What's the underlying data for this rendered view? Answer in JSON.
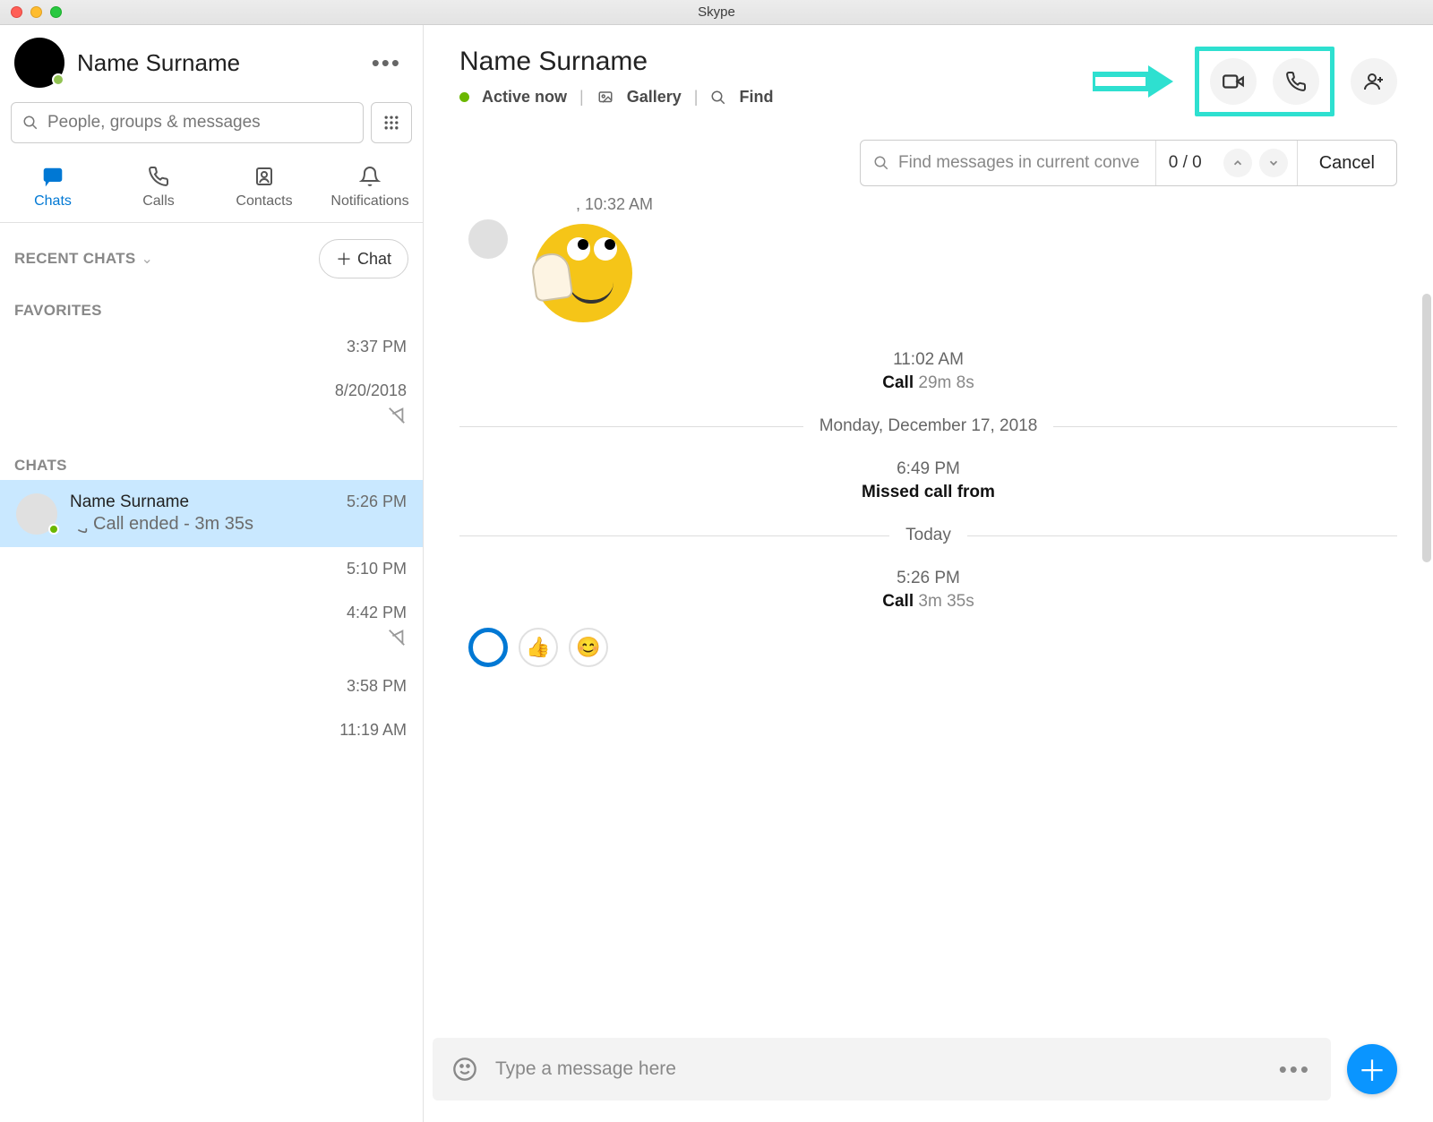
{
  "window": {
    "title": "Skype"
  },
  "profile": {
    "name": "Name Surname"
  },
  "search": {
    "placeholder": "People, groups & messages"
  },
  "tabs": {
    "chats": "Chats",
    "calls": "Calls",
    "contacts": "Contacts",
    "notifications": "Notifications",
    "active": "chats"
  },
  "recent": {
    "title": "RECENT CHATS",
    "new_chat_label": "Chat"
  },
  "favorites": {
    "title": "FAVORITES"
  },
  "chats_section": {
    "title": "CHATS"
  },
  "sidebar_items": [
    {
      "time": "3:37 PM"
    },
    {
      "time": "8/20/2018",
      "muted": true
    },
    {
      "selected": true,
      "name": "Name Surname",
      "sub": "Call ended - 3m 35s",
      "time": "5:26 PM"
    },
    {
      "time": "5:10 PM"
    },
    {
      "time": "4:42 PM",
      "muted": true
    },
    {
      "time": "3:58 PM"
    },
    {
      "time": "11:19 AM"
    }
  ],
  "conversation": {
    "title": "Name Surname",
    "status": "Active now",
    "gallery": "Gallery",
    "find": "Find"
  },
  "find_bar": {
    "placeholder": "Find messages in current conve",
    "count": "0 / 0",
    "cancel": "Cancel"
  },
  "messages": {
    "top_time": ", 10:32 AM",
    "call1": {
      "time": "11:02 AM",
      "label": "Call",
      "duration": "29m 8s"
    },
    "day1": "Monday, December 17, 2018",
    "missed": {
      "time": "6:49 PM",
      "label": "Missed call from"
    },
    "day2": "Today",
    "call2": {
      "time": "5:26 PM",
      "label": "Call",
      "duration": "3m 35s"
    }
  },
  "composer": {
    "placeholder": "Type a message here"
  }
}
